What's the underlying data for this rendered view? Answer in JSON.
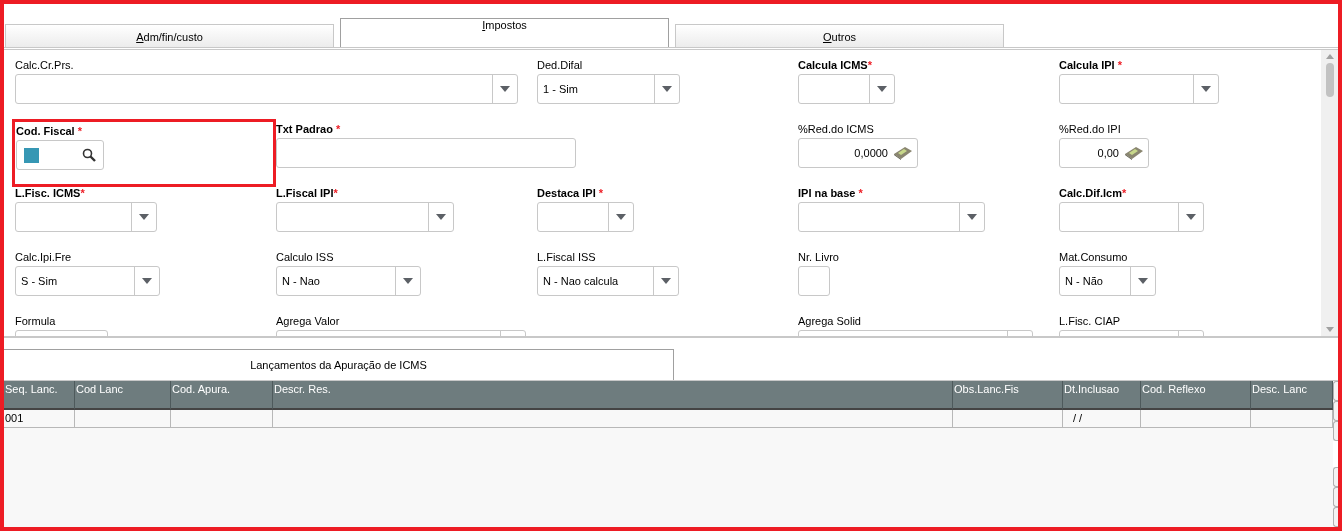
{
  "tabs": [
    {
      "label": "Adm/fin/custo",
      "selected": false
    },
    {
      "label": "Impostos",
      "selected": true
    },
    {
      "label": "Outros",
      "selected": false
    }
  ],
  "form_rows": [
    [
      {
        "label": "Calc.Cr.Prs.",
        "required": false,
        "kind": "combo"
      },
      {
        "label": "Ded.Difal",
        "required": false,
        "kind": "combo",
        "value": "1 - Sim"
      },
      {
        "label": "Calcula ICMS",
        "required": true,
        "required_mark": "*",
        "kind": "combo"
      },
      {
        "label": "Calcula IPI ",
        "required": true,
        "required_mark": "*",
        "kind": "combo"
      }
    ],
    [
      {
        "label": "Cod. Fiscal ",
        "required": true,
        "required_mark": "*",
        "kind": "lookup",
        "highlighted": true
      },
      {
        "label": "Txt Padrao ",
        "required": true,
        "required_mark": "*",
        "kind": "text"
      },
      {
        "label": "%Red.do ICMS",
        "required": false,
        "kind": "number",
        "value": "0,0000"
      },
      {
        "label": "%Red.do IPI",
        "required": false,
        "kind": "number",
        "value": "0,00"
      }
    ],
    [
      {
        "label": "L.Fisc. ICMS",
        "required": true,
        "required_mark": "*",
        "kind": "combo"
      },
      {
        "label": "L.Fiscal IPI",
        "required": true,
        "required_mark": "*",
        "kind": "combo"
      },
      {
        "label": "Destaca IPI ",
        "required": true,
        "required_mark": "*",
        "kind": "combo"
      },
      {
        "label": "IPI na base ",
        "required": true,
        "required_mark": "*",
        "kind": "combo"
      },
      {
        "label": "Calc.Dif.Icm",
        "required": true,
        "required_mark": "*",
        "kind": "combo"
      }
    ],
    [
      {
        "label": "Calc.Ipi.Fre",
        "required": false,
        "kind": "combo",
        "value": "S - Sim"
      },
      {
        "label": "Calculo ISS",
        "required": false,
        "kind": "combo",
        "value": "N - Nao"
      },
      {
        "label": "L.Fiscal ISS",
        "required": false,
        "kind": "combo",
        "value": "N - Nao calcula"
      },
      {
        "label": "Nr. Livro",
        "required": false,
        "kind": "text"
      },
      {
        "label": "Mat.Consumo",
        "required": false,
        "kind": "combo",
        "value": "N - Não"
      }
    ],
    [
      {
        "label": "Formula",
        "required": false,
        "kind": "text"
      },
      {
        "label": "Agrega Valor",
        "required": false,
        "kind": "combo"
      },
      {
        "label": "Agrega Solid",
        "required": false,
        "kind": "combo"
      },
      {
        "label": "L.Fisc. CIAP",
        "required": false,
        "kind": "combo"
      }
    ]
  ],
  "grid_tabs": [
    {
      "label": "Lançamentos da Apuração de ICMS",
      "selected": true
    }
  ],
  "table": {
    "columns": [
      "Seq. Lanc.",
      "Cod Lanc",
      "Cod. Apura.",
      "Descr. Res.",
      "Obs.Lanc.Fis",
      "Dt.Inclusao",
      "Cod. Reflexo",
      "Desc. Lanc"
    ],
    "rows": [
      [
        "001",
        null,
        null,
        null,
        null,
        "/ /",
        null,
        null
      ]
    ]
  }
}
